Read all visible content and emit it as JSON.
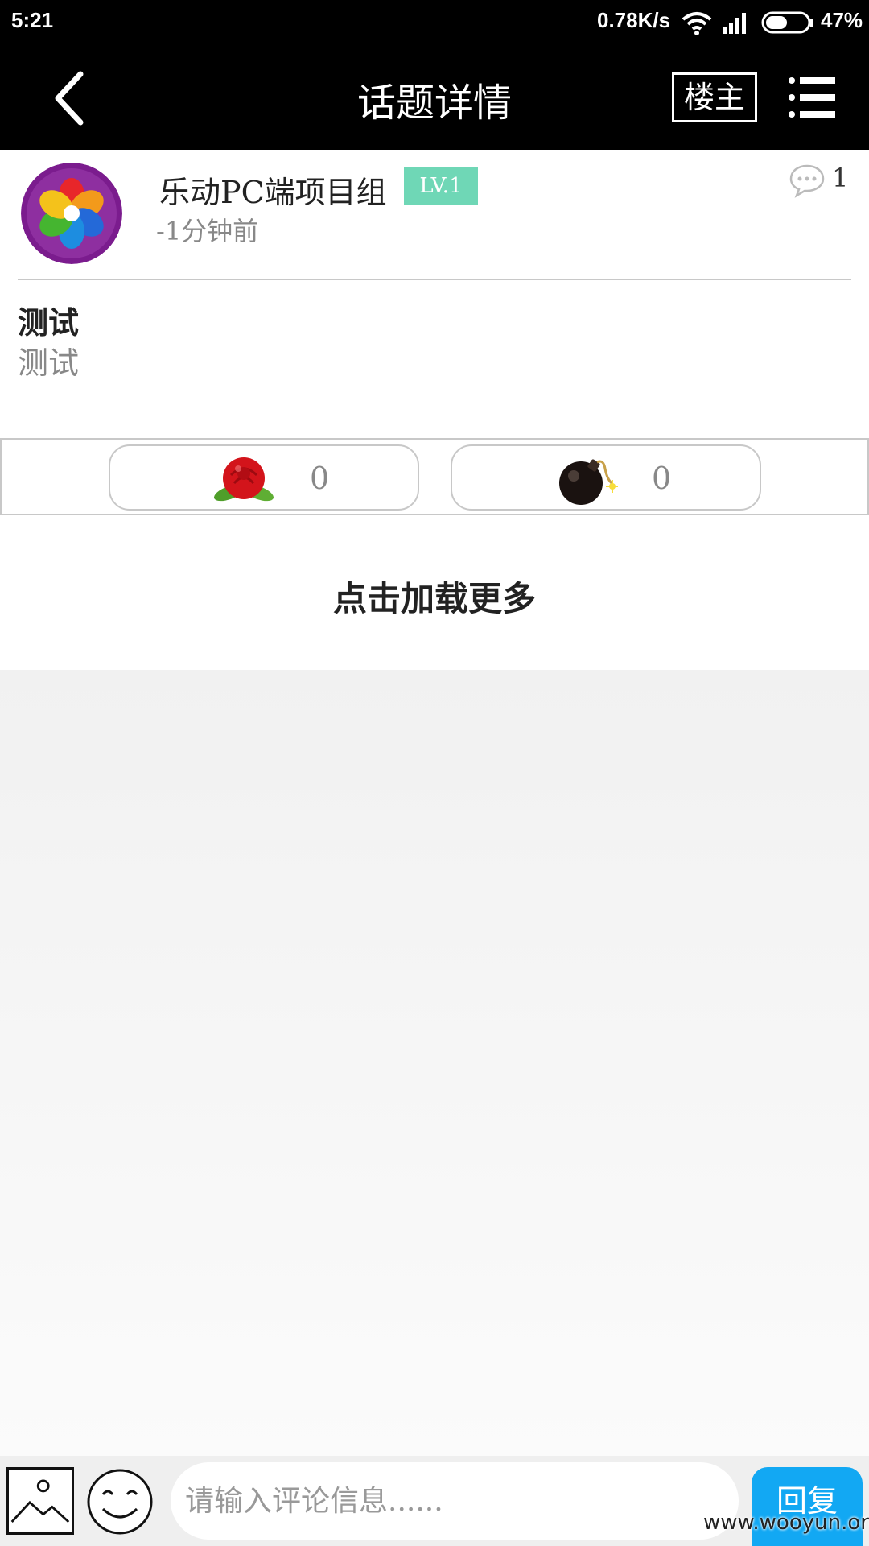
{
  "status_bar": {
    "time": "5:21",
    "network_speed": "0.78K/s",
    "battery": "47%",
    "icons": [
      "wifi-icon",
      "signal-icon",
      "battery-icon"
    ]
  },
  "header": {
    "back_icon": "chevron-left-icon",
    "title": "话题详情",
    "owner_label": "楼主",
    "menu_icon": "list-menu-icon",
    "background_color": "#000000"
  },
  "post": {
    "author": "乐动PC端项目组",
    "level": "LV.1",
    "level_color": "#6fd7b6",
    "time": "-1分钟前",
    "comment_icon": "speech-bubble-icon",
    "comment_count": "1",
    "title": "测试",
    "body": "测试"
  },
  "reactions": {
    "flower": {
      "icon": "rose-icon",
      "count": "0"
    },
    "bomb": {
      "icon": "bomb-icon",
      "count": "0"
    }
  },
  "load_more_label": "点击加载更多",
  "input_bar": {
    "image_icon": "image-icon",
    "emoji_icon": "smiley-icon",
    "placeholder": "请输入评论信息......",
    "reply_label": "回复",
    "accent_color": "#12a8f3"
  },
  "watermark": "www.wooyun.org"
}
